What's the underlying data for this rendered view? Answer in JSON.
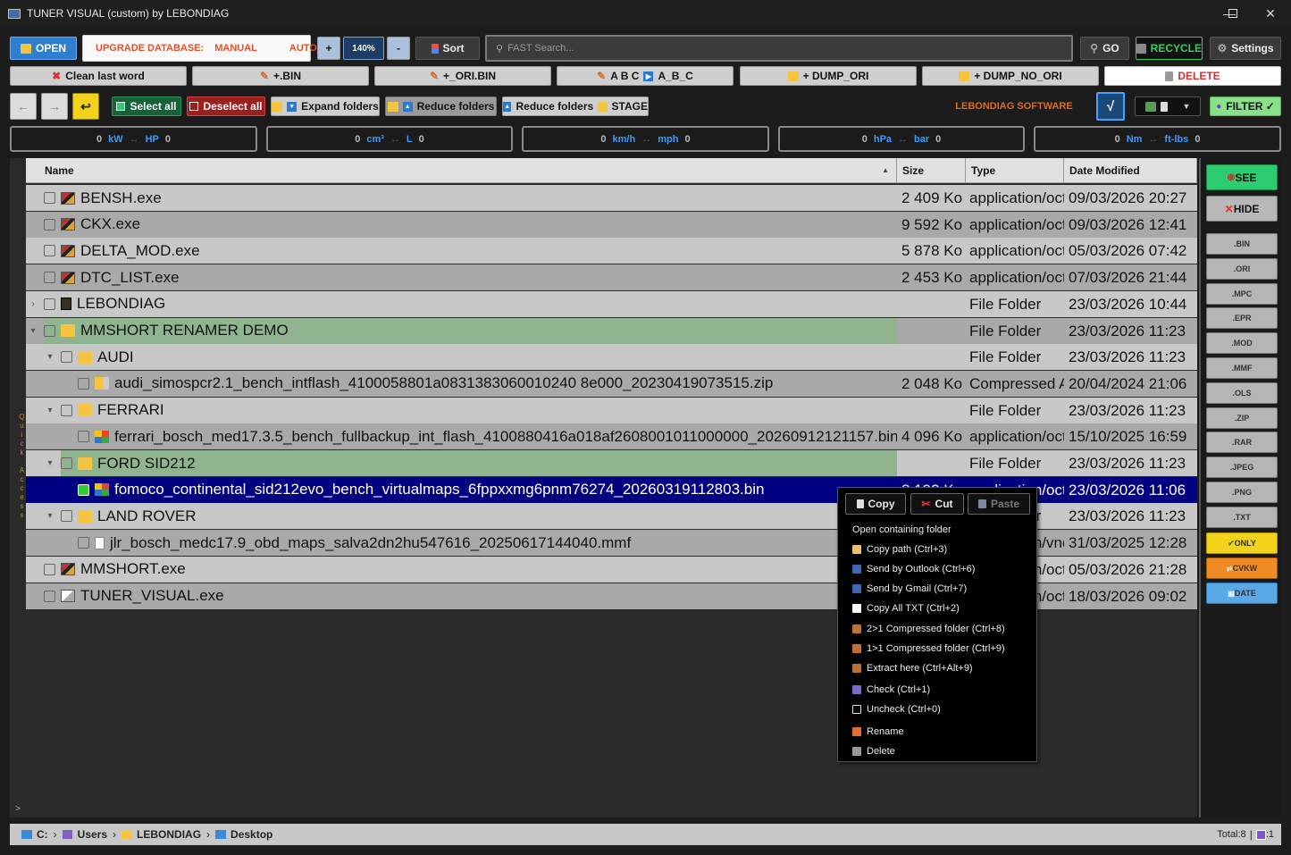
{
  "window": {
    "title": "TUNER VISUAL (custom) by LEBONDIAG"
  },
  "toolbar": {
    "open": "OPEN",
    "upgrade_label": "UPGRADE DATABASE:",
    "upgrade_manual": "MANUAL",
    "upgrade_auto": "AUTO",
    "zoom_plus": "+",
    "zoom": "140%",
    "zoom_minus": "-",
    "sort": "Sort",
    "search_placeholder": "FAST Search...",
    "go": "GO",
    "recycle": "RECYCLE",
    "settings": "Settings"
  },
  "row2": {
    "clean_last_word": "Clean last word",
    "bin": "+.BIN",
    "ori_bin": "+_ORI.BIN",
    "abc_from": "A B C",
    "abc_to": "A_B_C",
    "dump_ori": "+ DUMP_ORI",
    "dump_no_ori": "+ DUMP_NO_ORI",
    "delete": "DELETE"
  },
  "row3": {
    "back": "←",
    "forward": "→",
    "select_all": "Select all",
    "deselect_all": "Deselect all",
    "expand_folders": "Expand folders",
    "reduce_folders": "Reduce folders",
    "reduce_folders_stage": "Reduce folders",
    "stage": "STAGE",
    "brand": "LEBONDIAG SOFTWARE",
    "check": "√",
    "filter": "FILTER ✓"
  },
  "converters": [
    {
      "left": "0",
      "u1": "kW",
      "u2": "HP",
      "right": "0"
    },
    {
      "left": "0",
      "u1": "cm³",
      "u2": "L",
      "right": "0"
    },
    {
      "left": "0",
      "u1": "km/h",
      "u2": "mph",
      "right": "0"
    },
    {
      "left": "0",
      "u1": "hPa",
      "u2": "bar",
      "right": "0"
    },
    {
      "left": "0",
      "u1": "Nm",
      "u2": "ft-lbs",
      "right": "0"
    }
  ],
  "quick_access": "Quick Access",
  "quick_toggle": ">",
  "columns": {
    "name": "Name",
    "size": "Size",
    "type": "Type",
    "date": "Date Modified"
  },
  "files": [
    {
      "name": "BENSH.exe",
      "size": "2 409 Ko",
      "type": "application/octet-stream",
      "date": "09/03/2026 20:27"
    },
    {
      "name": "CKX.exe",
      "size": "9 592 Ko",
      "type": "application/octet-stream",
      "date": "09/03/2026 12:41"
    },
    {
      "name": "DELTA_MOD.exe",
      "size": "5 878 Ko",
      "type": "application/octet-stream",
      "date": "05/03/2026 07:42"
    },
    {
      "name": "DTC_LIST.exe",
      "size": "2 453 Ko",
      "type": "application/octet-stream",
      "date": "07/03/2026 21:44"
    },
    {
      "name": "LEBONDIAG",
      "size": "",
      "type": "File Folder",
      "date": "23/03/2026 10:44"
    },
    {
      "name": "MMSHORT RENAMER DEMO",
      "size": "",
      "type": "File Folder",
      "date": "23/03/2026 11:23"
    },
    {
      "name": "AUDI",
      "size": "",
      "type": "File Folder",
      "date": "23/03/2026 11:23"
    },
    {
      "name": "audi_simospcr2.1_bench_intflash_4100058801a0831383060010240 8e000_20230419073515.zip",
      "size": "2 048 Ko",
      "type": "Compressed Archive",
      "date": "20/04/2024 21:06"
    },
    {
      "name": "FERRARI",
      "size": "",
      "type": "File Folder",
      "date": "23/03/2026 11:23"
    },
    {
      "name": "ferrari_bosch_med17.3.5_bench_fullbackup_int_flash_4100880416a018af2608001011000000_20260912121157.bin",
      "size": "4 096 Ko",
      "type": "application/octet-stream",
      "date": "15/10/2025 16:59"
    },
    {
      "name": "FORD SID212",
      "size": "",
      "type": "File Folder",
      "date": "23/03/2026 11:23"
    },
    {
      "name": "fomoco_continental_sid212evo_bench_virtualmaps_6fppxxmg6pnm76274_20260319112803.bin",
      "size": "8 192 Ko",
      "type": "application/octet-stream",
      "date": "23/03/2026 11:06"
    },
    {
      "name": "LAND ROVER",
      "size": "",
      "type": "File Folder",
      "date": "23/03/2026 11:23"
    },
    {
      "name": "jlr_bosch_medc17.9_obd_maps_salva2dn2hu547616_20250617144040.mmf",
      "size": "",
      "type": "application/vnd",
      "date": "31/03/2025 12:28"
    },
    {
      "name": "MMSHORT.exe",
      "size": "",
      "type": "application/octet-stream",
      "date": "05/03/2026 21:28"
    },
    {
      "name": "TUNER_VISUAL.exe",
      "size": "",
      "type": "application/octet-stream",
      "date": "18/03/2026 09:02"
    }
  ],
  "right_panel": {
    "see": "SEE",
    "hide": "HIDE",
    "filters": [
      ".BIN",
      ".ORI",
      ".MPC",
      ".EPR",
      ".MOD",
      ".MMF",
      ".OLS",
      ".ZIP",
      ".RAR",
      ".JPEG",
      ".PNG",
      ".TXT"
    ],
    "only": "ONLY",
    "cvkw": "CVKW",
    "date": "DATE"
  },
  "context_menu": {
    "copy": "Copy",
    "cut": "Cut",
    "paste": "Paste",
    "items": [
      "Open containing folder",
      "Copy path (Ctrl+3)",
      "Send by Outlook (Ctrl+6)",
      "Send by Gmail (Ctrl+7)",
      "Copy All TXT (Ctrl+2)",
      "2>1 Compressed folder (Ctrl+8)",
      "1>1 Compressed folder (Ctrl+9)",
      "Extract here (Ctrl+Alt+9)",
      "Check (Ctrl+1)",
      "Uncheck (Ctrl+0)",
      "Rename",
      "Delete"
    ]
  },
  "statusbar": {
    "drive": "C:",
    "p1": "Users",
    "p2": "LEBONDIAG",
    "p3": "Desktop",
    "total": "Total:8",
    "checked": ":1"
  },
  "colors": {
    "selected_row": "#000080",
    "folder_open_row": "#8fb48f",
    "accent_blue": "#1f6fb8",
    "recycle_green": "#1aa84a",
    "delete_red": "#d83030",
    "see_green": "#2ecc71",
    "only_yellow": "#f2d21b",
    "cvkw_orange": "#f08a24",
    "date_blue": "#5aa8e6"
  }
}
